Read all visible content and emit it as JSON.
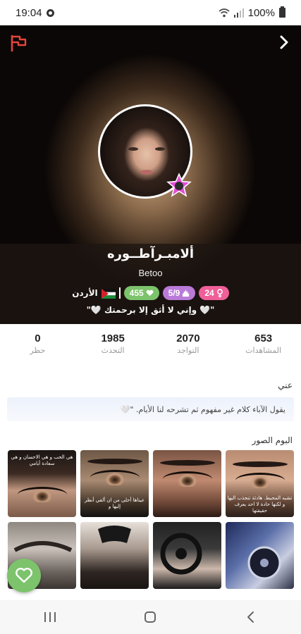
{
  "status_bar": {
    "time": "19:04",
    "battery": "100%",
    "icons": [
      "whatsapp-icon",
      "wifi-icon",
      "signal-icon",
      "battery-icon"
    ]
  },
  "header": {
    "icons": [
      "flag-icon",
      "chevron-right-icon"
    ],
    "accent": "#e2453c",
    "username": "ألامبـرآطــوره",
    "subname": "Betoo",
    "badges": {
      "country": "الأردن",
      "likes": "455",
      "level": "5/9",
      "age": "24"
    },
    "bio": "\"🤍 وإني لا أثق إلا برحمتك 🤍\""
  },
  "stats": [
    {
      "value": "653",
      "label": "المشاهدات"
    },
    {
      "value": "2070",
      "label": "التواجد"
    },
    {
      "value": "1985",
      "label": "التحدث"
    },
    {
      "value": "0",
      "label": "حظر"
    }
  ],
  "about": {
    "title": "عني",
    "text": "يقول الآباء كلام غير مفهوم ثم تشرحه لنا الأيام. \"🤍"
  },
  "gallery": {
    "title": "البوم الصور",
    "captions": [
      "تشبه المحيط. هادئة تنجذب اليها و لكنها حادة لا احد يعرف حقيقتها",
      "عيناها أحلى من ان ألقي أنظر إليها و",
      "",
      "هي الحب و هي الاحسان و هي سعادة أيامي",
      "",
      "",
      "",
      ""
    ]
  },
  "colors": {
    "green": "#7cc36c",
    "purple": "#b97ad8",
    "pink": "#ef5f98",
    "label_gray": "#9a9a9a"
  }
}
